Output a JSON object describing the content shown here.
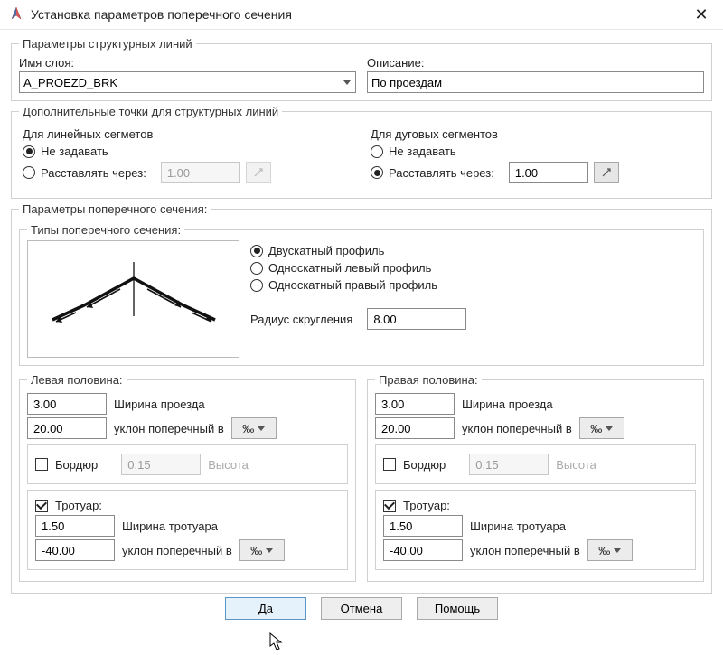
{
  "window": {
    "title": "Установка параметров поперечного сечения"
  },
  "structLines": {
    "legend": "Параметры структурных линий",
    "layerLabel": "Имя слоя:",
    "layerValue": "A_PROEZD_BRK",
    "descLabel": "Описание:",
    "descValue": "По проездам"
  },
  "extraPoints": {
    "legend": "Дополнительные точки для структурных линий",
    "lineLegend": "Для линейных сегметов",
    "arcLegend": "Для дуговых сегментов",
    "optNone": "Не задавать",
    "optSpacing": "Расставлять через:",
    "lineSelected": "none",
    "lineSpacing": "1.00",
    "arcSelected": "spacing",
    "arcSpacing": "1.00"
  },
  "crossSection": {
    "legend": "Параметры поперечного сечения:",
    "typesLegend": "Типы поперечного сечения:",
    "profileOptions": {
      "gable": "Двускатный профиль",
      "singleLeft": "Односкатный левый профиль",
      "singleRight": "Односкатный правый профиль"
    },
    "profileSelected": "gable",
    "radiusLabel": "Радиус скругления",
    "radiusValue": "8.00"
  },
  "halves": {
    "leftLegend": "Левая половина:",
    "rightLegend": "Правая половина:",
    "widthLabel": "Ширина проезда",
    "slopeLabel": "уклон поперечный в",
    "curbLabel": "Бордюр",
    "curbHeightLabel": "Высота",
    "sidewalkLabel": "Тротуар:",
    "sidewalkWidthLabel": "Ширина тротуара",
    "unit": "‰",
    "left": {
      "width": "3.00",
      "slope": "20.00",
      "curbChecked": false,
      "curbHeight": "0.15",
      "sidewalkChecked": true,
      "sidewalkWidth": "1.50",
      "sidewalkSlope": "-40.00"
    },
    "right": {
      "width": "3.00",
      "slope": "20.00",
      "curbChecked": false,
      "curbHeight": "0.15",
      "sidewalkChecked": true,
      "sidewalkWidth": "1.50",
      "sidewalkSlope": "-40.00"
    }
  },
  "buttons": {
    "ok": "Да",
    "cancel": "Отмена",
    "help": "Помощь"
  }
}
